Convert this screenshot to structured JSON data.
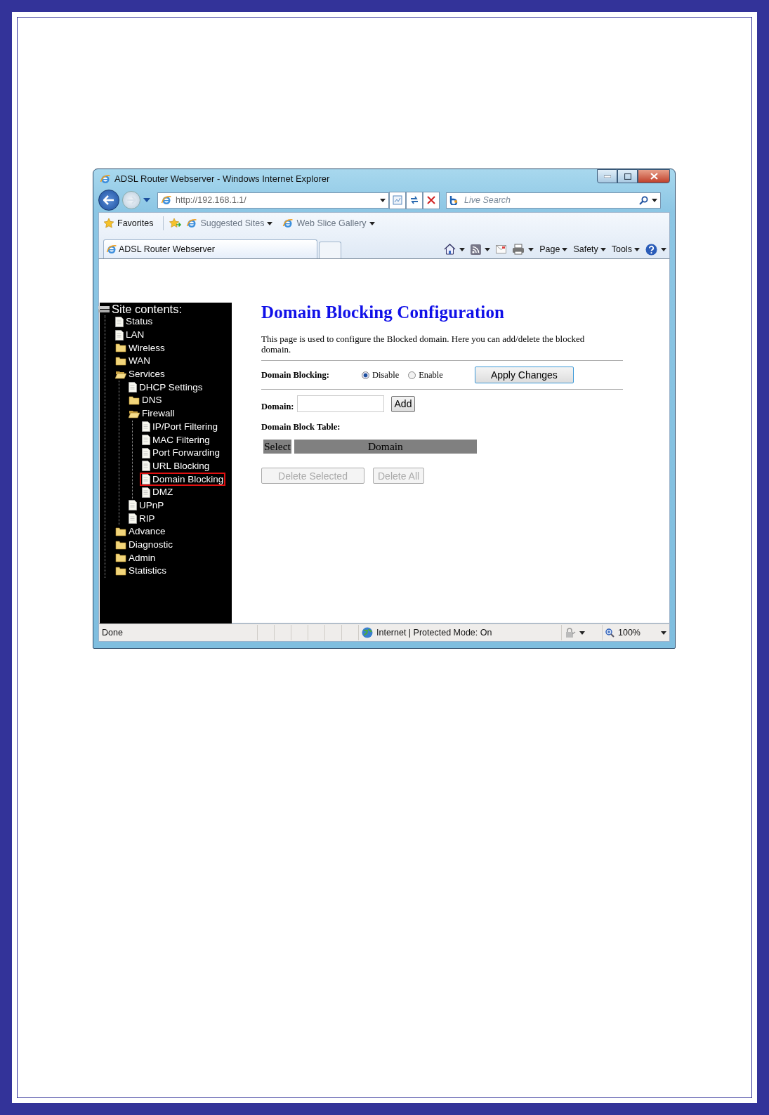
{
  "browser": {
    "title": "ADSL Router Webserver - Windows Internet Explorer",
    "address": "http://192.168.1.1/",
    "search": {
      "placeholder": "Live Search"
    },
    "favorites": [
      {
        "label": "Favorites",
        "kind": "star"
      },
      {
        "label": "Suggested Sites",
        "kind": "page"
      },
      {
        "label": "Web Slice Gallery",
        "kind": "page"
      }
    ],
    "tab": "ADSL Router Webserver",
    "commands": [
      "Page",
      "Safety",
      "Tools"
    ]
  },
  "sidebar": {
    "title": "Site contents:",
    "items": [
      {
        "label": "Status",
        "kind": "page",
        "selected": false
      },
      {
        "label": "LAN",
        "kind": "page",
        "selected": false
      },
      {
        "label": "Wireless",
        "kind": "folder",
        "expanded": false,
        "selected": false
      },
      {
        "label": "WAN",
        "kind": "folder",
        "expanded": false,
        "selected": false
      },
      {
        "label": "Services",
        "kind": "folder",
        "expanded": true,
        "selected": false,
        "children": [
          {
            "label": "DHCP Settings",
            "kind": "page",
            "selected": false
          },
          {
            "label": "DNS",
            "kind": "folder",
            "expanded": false,
            "selected": false
          },
          {
            "label": "Firewall",
            "kind": "folder",
            "expanded": true,
            "selected": false,
            "children": [
              {
                "label": "IP/Port Filtering",
                "kind": "page",
                "selected": false
              },
              {
                "label": "MAC Filtering",
                "kind": "page",
                "selected": false
              },
              {
                "label": "Port Forwarding",
                "kind": "page",
                "selected": false
              },
              {
                "label": "URL Blocking",
                "kind": "page",
                "selected": false
              },
              {
                "label": "Domain Blocking",
                "kind": "page",
                "selected": true
              },
              {
                "label": "DMZ",
                "kind": "page",
                "selected": false
              }
            ]
          },
          {
            "label": "UPnP",
            "kind": "page",
            "selected": false
          },
          {
            "label": "RIP",
            "kind": "page",
            "selected": false
          }
        ]
      },
      {
        "label": "Advance",
        "kind": "folder",
        "expanded": false,
        "selected": false
      },
      {
        "label": "Diagnostic",
        "kind": "folder",
        "expanded": false,
        "selected": false
      },
      {
        "label": "Admin",
        "kind": "folder",
        "expanded": false,
        "selected": false
      },
      {
        "label": "Statistics",
        "kind": "folder",
        "expanded": false,
        "selected": false
      }
    ]
  },
  "page": {
    "title": "Domain Blocking Configuration",
    "description": "This page is used to configure the Blocked domain. Here you can add/delete the blocked domain.",
    "domain_blocking": {
      "label": "Domain Blocking:",
      "options": [
        {
          "label": "Disable",
          "selected": true
        },
        {
          "label": "Enable",
          "selected": false
        }
      ],
      "apply": "Apply Changes"
    },
    "domain": {
      "label": "Domain:",
      "add": "Add"
    },
    "table": {
      "title": "Domain Block Table:",
      "columns": [
        "Select",
        "Domain"
      ]
    },
    "buttons": [
      {
        "label": "Delete Selected",
        "disabled": true
      },
      {
        "label": "Delete All",
        "disabled": true
      }
    ]
  },
  "status_bar": {
    "text": "Done",
    "zone": "Internet | Protected Mode: On",
    "zoom": "100%"
  }
}
